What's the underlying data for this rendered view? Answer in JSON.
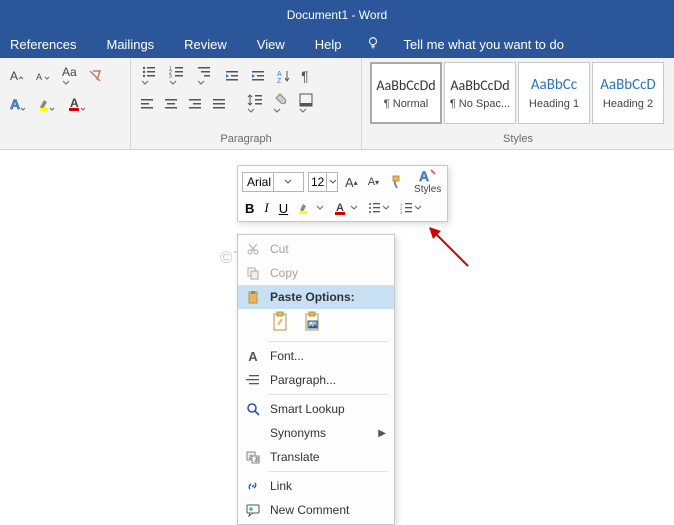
{
  "title": "Document1  -  Word",
  "menu": {
    "references": "References",
    "mailings": "Mailings",
    "review": "Review",
    "view": "View",
    "help": "Help",
    "tellme": "Tell me what you want to do"
  },
  "ribbon": {
    "paragraph_label": "Paragraph",
    "styles_label": "Styles",
    "style_tiles": [
      {
        "preview": "AaBbCcDd",
        "name": "¶ Normal",
        "blue": false,
        "selected": true
      },
      {
        "preview": "AaBbCcDd",
        "name": "¶ No Spac...",
        "blue": false,
        "selected": false
      },
      {
        "preview": "AaBbCc",
        "name": "Heading 1",
        "blue": true,
        "selected": false
      },
      {
        "preview": "AaBbCcD",
        "name": "Heading 2",
        "blue": true,
        "selected": false
      }
    ]
  },
  "mini": {
    "font": "Arial",
    "size": "12",
    "styles_btn": "Styles",
    "bold": "B",
    "italic": "I",
    "underline": "U"
  },
  "context_menu": {
    "cut": "Cut",
    "copy": "Copy",
    "paste_options": "Paste Options:",
    "font": "Font...",
    "paragraph": "Paragraph...",
    "smart_lookup": "Smart Lookup",
    "synonyms": "Synonyms",
    "translate": "Translate",
    "link": "Link",
    "new_comment": "New Comment"
  },
  "watermark": "©TheGeekPage.com"
}
